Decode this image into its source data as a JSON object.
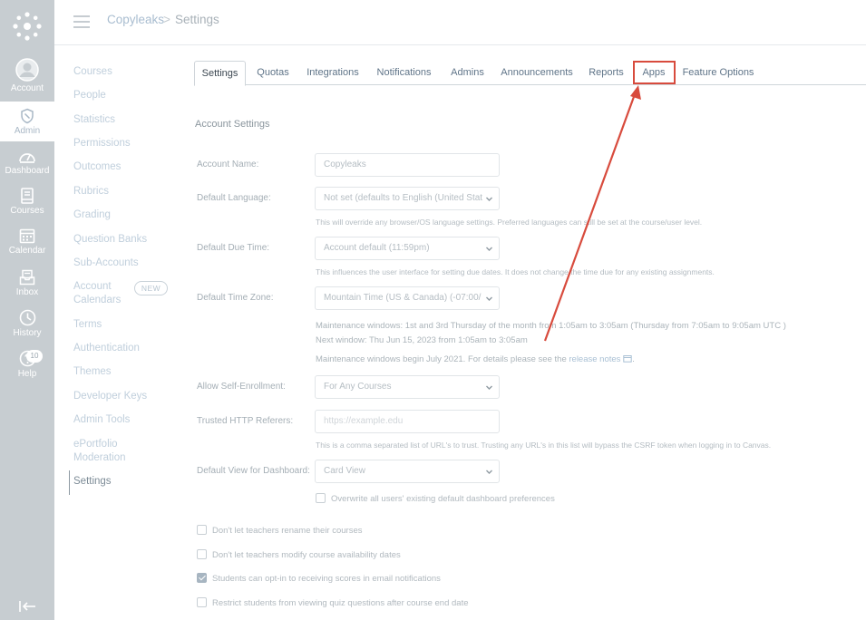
{
  "global_nav": {
    "items": [
      {
        "label": "Account",
        "icon": "avatar-icon"
      },
      {
        "label": "Admin",
        "icon": "shield-icon"
      },
      {
        "label": "Dashboard",
        "icon": "dashboard-icon"
      },
      {
        "label": "Courses",
        "icon": "courses-icon"
      },
      {
        "label": "Calendar",
        "icon": "calendar-icon"
      },
      {
        "label": "Inbox",
        "icon": "inbox-icon"
      },
      {
        "label": "History",
        "icon": "history-icon"
      },
      {
        "label": "Help",
        "icon": "help-icon",
        "badge": "10"
      }
    ],
    "collapse_icon": "collapse-nav-icon"
  },
  "header": {
    "breadcrumb_root": "Copyleaks",
    "breadcrumb_sep": ">",
    "breadcrumb_current": "Settings"
  },
  "left_menu": {
    "items": [
      "Courses",
      "People",
      "Statistics",
      "Permissions",
      "Outcomes",
      "Rubrics",
      "Grading",
      "Question Banks",
      "Sub-Accounts",
      "Account",
      "Calendars",
      "Terms",
      "Authentication",
      "Themes",
      "Developer Keys",
      "Admin Tools",
      "ePortfolio",
      "Moderation",
      "Settings"
    ],
    "new_pill": "NEW"
  },
  "tabs": [
    "Settings",
    "Quotas",
    "Integrations",
    "Notifications",
    "Admins",
    "Announcements",
    "Reports",
    "Apps",
    "Feature Options"
  ],
  "form": {
    "section_title": "Account Settings",
    "account_name_label": "Account Name:",
    "account_name_value": "Copyleaks",
    "default_language_label": "Default Language:",
    "default_language_value": "Not set (defaults to English (United Stat",
    "default_language_help": "This will override any browser/OS language settings. Preferred languages can still be set at the course/user level.",
    "due_time_label": "Default Due Time:",
    "due_time_value": "Account default (11:59pm)",
    "due_time_help": "This influences the user interface for setting due dates. It does not change the time due for any existing assignments.",
    "time_zone_label": "Default Time Zone:",
    "time_zone_value": "Mountain Time (US & Canada) (-07:00/",
    "maintenance_line1": "Maintenance windows: 1st and 3rd Thursday of the month from 1:05am to 3:05am (Thursday from 7:05am to 9:05am UTC )",
    "maintenance_line2": "Next window: Thu Jun 15, 2023 from 1:05am to 3:05am",
    "maintenance_line3_pre": "Maintenance windows begin July 2021. For details please see the",
    "release_notes_link": "release notes",
    "self_enroll_label": "Allow Self-Enrollment:",
    "self_enroll_value": "For Any Courses",
    "trusted_referers_label": "Trusted HTTP Referers:",
    "trusted_referers_placeholder": "https://example.edu",
    "trusted_referers_help": "This is a comma separated list of URL's to trust. Trusting any URL's in this list will bypass the CSRF token when logging in to Canvas.",
    "dashboard_view_label": "Default View for Dashboard:",
    "dashboard_view_value": "Card View",
    "overwrite_label": "Overwrite all users' existing default dashboard preferences",
    "checkboxes": [
      {
        "label": "Don't let teachers rename their courses",
        "checked": false
      },
      {
        "label": "Don't let teachers modify course availability dates",
        "checked": false
      },
      {
        "label": "Students can opt-in to receiving scores in email notifications",
        "checked": true
      },
      {
        "label": "Restrict students from viewing quiz questions after course end date",
        "checked": false
      }
    ]
  },
  "annotation": {
    "highlight_color": "#d84b3d"
  }
}
